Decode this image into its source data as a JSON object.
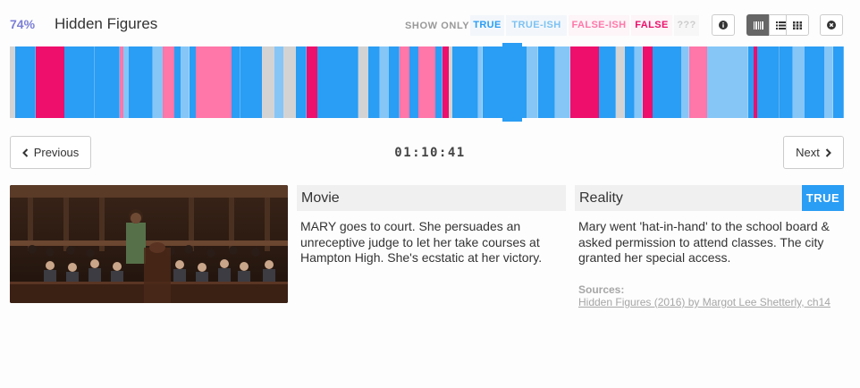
{
  "header": {
    "score": "74%",
    "title": "Hidden Figures",
    "show_only_label": "SHOW ONLY",
    "filters": {
      "true": "TRUE",
      "true_ish": "TRUE-ISH",
      "false_ish": "FALSE-ISH",
      "false": "FALSE",
      "unknown": "???"
    },
    "icons": {
      "info": "info-icon",
      "barcode_view": "barcode-view-icon",
      "list_view": "list-view-icon",
      "grid_view": "grid-view-icon",
      "close": "close-icon"
    }
  },
  "colors": {
    "true": "#2a9df4",
    "true_ish": "#85c6f7",
    "false_ish": "#ff76a8",
    "false": "#ee0e6b",
    "unknown": "#d3d3d3",
    "score": "#7b7fd6"
  },
  "timeline": {
    "segments": [
      {
        "verdict": "unknown",
        "fraction": 0.006
      },
      {
        "verdict": "true",
        "fraction": 0.024
      },
      {
        "verdict": "false",
        "fraction": 0.034
      },
      {
        "verdict": "true",
        "fraction": 0.036
      },
      {
        "verdict": "true",
        "fraction": 0.018
      },
      {
        "verdict": "true",
        "fraction": 0.011
      },
      {
        "verdict": "false_ish",
        "fraction": 0.005
      },
      {
        "verdict": "true_ish",
        "fraction": 0.006
      },
      {
        "verdict": "true",
        "fraction": 0.028
      },
      {
        "verdict": "true_ish",
        "fraction": 0.012
      },
      {
        "verdict": "false_ish",
        "fraction": 0.013
      },
      {
        "verdict": "true",
        "fraction": 0.008
      },
      {
        "verdict": "true_ish",
        "fraction": 0.01
      },
      {
        "verdict": "true",
        "fraction": 0.008
      },
      {
        "verdict": "false_ish",
        "fraction": 0.042
      },
      {
        "verdict": "true",
        "fraction": 0.01
      },
      {
        "verdict": "true",
        "fraction": 0.026
      },
      {
        "verdict": "unknown",
        "fraction": 0.014
      },
      {
        "verdict": "true_ish",
        "fraction": 0.011
      },
      {
        "verdict": "unknown",
        "fraction": 0.014
      },
      {
        "verdict": "true",
        "fraction": 0.013
      },
      {
        "verdict": "false",
        "fraction": 0.013
      },
      {
        "verdict": "true",
        "fraction": 0.048
      },
      {
        "verdict": "unknown",
        "fraction": 0.012
      },
      {
        "verdict": "true",
        "fraction": 0.013
      },
      {
        "verdict": "true_ish",
        "fraction": 0.011
      },
      {
        "verdict": "true",
        "fraction": 0.012
      },
      {
        "verdict": "false_ish",
        "fraction": 0.012
      },
      {
        "verdict": "true",
        "fraction": 0.011
      },
      {
        "verdict": "false_ish",
        "fraction": 0.019
      },
      {
        "verdict": "true",
        "fraction": 0.009
      },
      {
        "verdict": "false",
        "fraction": 0.007
      },
      {
        "verdict": "unknown",
        "fraction": 0.004
      },
      {
        "verdict": "true",
        "fraction": 0.031
      },
      {
        "verdict": "true_ish",
        "fraction": 0.005
      },
      {
        "verdict": "true",
        "fraction": 0.052
      },
      {
        "verdict": "true_ish",
        "fraction": 0.013
      },
      {
        "verdict": "true",
        "fraction": 0.02
      },
      {
        "verdict": "true_ish",
        "fraction": 0.018
      },
      {
        "verdict": "false",
        "fraction": 0.034
      },
      {
        "verdict": "true",
        "fraction": 0.02
      },
      {
        "verdict": "unknown",
        "fraction": 0.01
      },
      {
        "verdict": "true",
        "fraction": 0.012
      },
      {
        "verdict": "true_ish",
        "fraction": 0.009
      },
      {
        "verdict": "false",
        "fraction": 0.012
      },
      {
        "verdict": "true",
        "fraction": 0.034
      },
      {
        "verdict": "true_ish",
        "fraction": 0.009
      },
      {
        "verdict": "false_ish",
        "fraction": 0.021
      },
      {
        "verdict": "true_ish",
        "fraction": 0.048
      },
      {
        "verdict": "true",
        "fraction": 0.007
      },
      {
        "verdict": "false",
        "fraction": 0.004
      },
      {
        "verdict": "true",
        "fraction": 0.026
      },
      {
        "verdict": "true",
        "fraction": 0.016
      },
      {
        "verdict": "true_ish",
        "fraction": 0.014
      },
      {
        "verdict": "true",
        "fraction": 0.023
      },
      {
        "verdict": "true_ish",
        "fraction": 0.01
      },
      {
        "verdict": "true",
        "fraction": 0.013
      }
    ],
    "current_position_fraction": 0.591
  },
  "navigation": {
    "previous_label": "Previous",
    "next_label": "Next",
    "timecode": "01:10:41"
  },
  "scene": {
    "image_label": "Courtroom scene still"
  },
  "movie": {
    "heading": "Movie",
    "text": "MARY goes to court. She persuades an unreceptive judge to let her take courses at Hampton High. She's ecstatic at her victory."
  },
  "reality": {
    "heading": "Reality",
    "verdict": "TRUE",
    "text": "Mary went 'hat-in-hand' to the school board & asked permission to attend classes. The city granted her special access.",
    "sources_label": "Sources:",
    "source_link": "Hidden Figures (2016) by Margot Lee Shetterly, ch14"
  }
}
